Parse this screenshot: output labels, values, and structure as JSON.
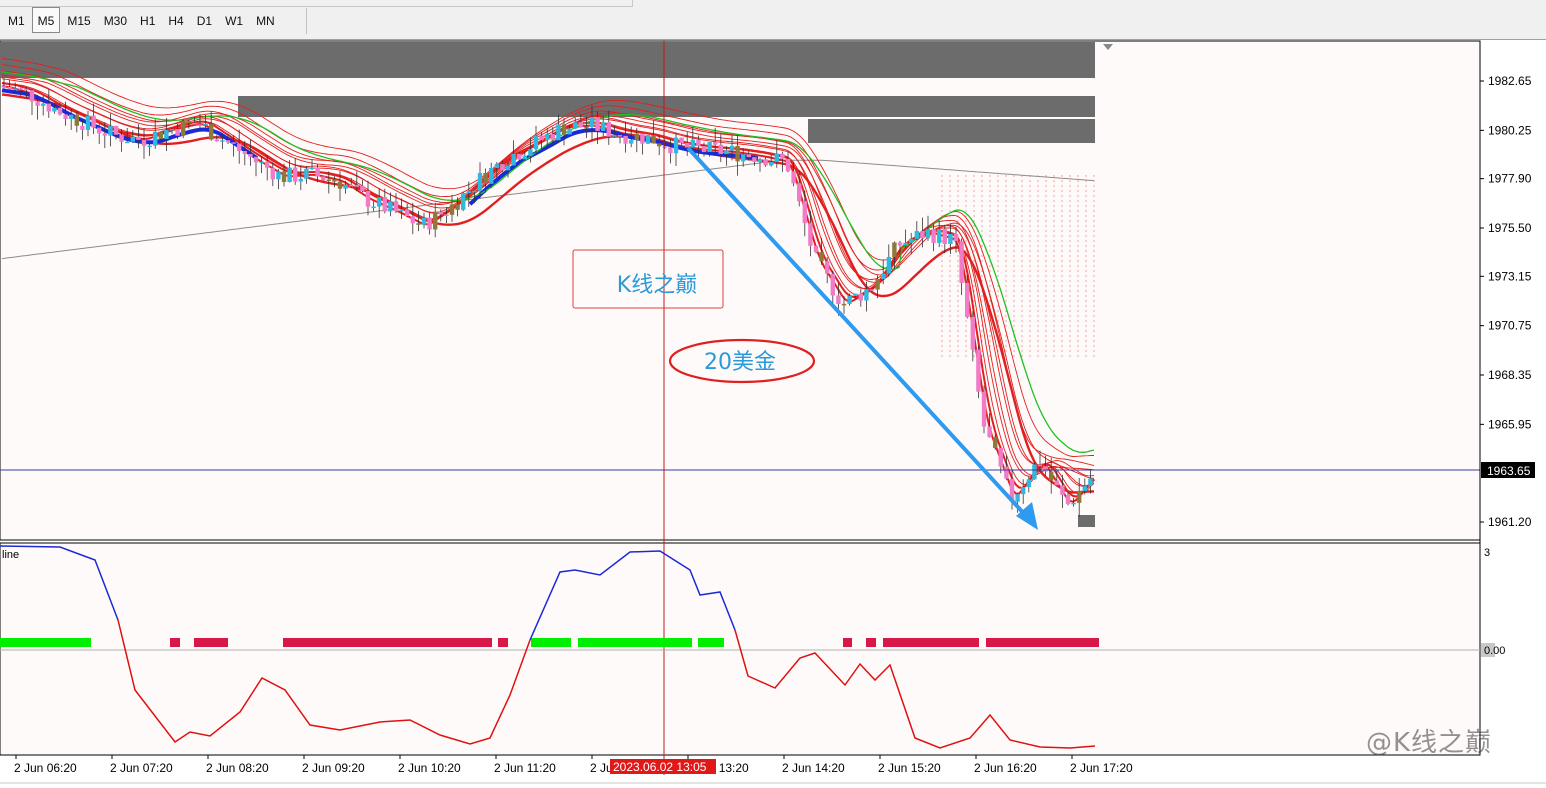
{
  "toolbar": {
    "timeframes": [
      {
        "label": "M1",
        "active": false
      },
      {
        "label": "M5",
        "active": true
      },
      {
        "label": "M15",
        "active": false
      },
      {
        "label": "M30",
        "active": false
      },
      {
        "label": "H1",
        "active": false
      },
      {
        "label": "H4",
        "active": false
      },
      {
        "label": "D1",
        "active": false
      },
      {
        "label": "W1",
        "active": false
      },
      {
        "label": "MN",
        "active": false
      }
    ]
  },
  "chart_data": {
    "type": "candlestick",
    "price_axis": {
      "ticks": [
        "1982.65",
        "1980.25",
        "1977.90",
        "1975.50",
        "1973.15",
        "1970.75",
        "1968.35",
        "1965.95",
        "1963.65",
        "1961.20"
      ],
      "ylim": [
        1960.0,
        1984.6
      ],
      "current_price": "1963.65"
    },
    "time_axis": {
      "ticks": [
        "2 Jun 06:20",
        "2 Jun 07:20",
        "2 Jun 08:20",
        "2 Jun 09:20",
        "2 Jun 10:20",
        "2 Jun 11:20",
        "2 Jun 12:20",
        "2 Jun 13:20",
        "2 Jun 14:20",
        "2 Jun 15:20",
        "2 Jun 16:20",
        "2 Jun 17:20"
      ],
      "crosshair_label": "2023.06.02 13:05"
    },
    "close_path": [
      1982.4,
      1982.0,
      1981.2,
      1980.6,
      1980.0,
      1979.8,
      1980.3,
      1980.6,
      1979.7,
      1978.8,
      1978.0,
      1978.1,
      1977.8,
      1976.9,
      1976.3,
      1975.6,
      1976.5,
      1977.8,
      1978.9,
      1979.6,
      1980.4,
      1980.5,
      1980.1,
      1979.9,
      1979.5,
      1979.3,
      1979.2,
      1979.0,
      1978.7,
      1974.0,
      1971.8,
      1972.6,
      1974.7,
      1975.3,
      1974.9,
      1966.0,
      1962.3,
      1964.2,
      1962.0,
      1963.6
    ],
    "annotations": {
      "title_box": "K线之巅",
      "ellipse_label": "20美金"
    },
    "indicator": {
      "label": "line",
      "levels": [
        "3",
        "0.00"
      ]
    }
  },
  "watermark": "@K线之巅",
  "colors": {
    "bull_candle": "#2fb8e0",
    "bear_candle": "#f07cc8",
    "neutral_candle": "#8c7a3a",
    "ribbon_red": "#e02020",
    "ribbon_blue": "#1a2ad8",
    "ma_green": "#20c020",
    "arrow": "#2e9bf0",
    "supply_zone": "#6c6c6c",
    "indicator_bull": "#00ee00",
    "indicator_bear": "#d81848",
    "crosshair": "#c01818"
  }
}
